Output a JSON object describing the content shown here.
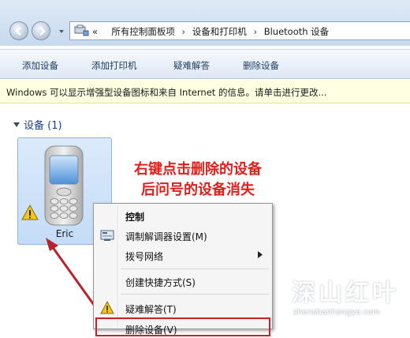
{
  "breadcrumb": {
    "lead": "«",
    "items": [
      "所有控制面板项",
      "设备和打印机",
      "Bluetooth 设备"
    ],
    "separator": "›"
  },
  "toolbar": {
    "add_device": "添加设备",
    "add_printer": "添加打印机",
    "troubleshoot": "疑难解答",
    "remove_device": "删除设备"
  },
  "infobar": {
    "text": "Windows 可以显示增强型设备图标和来自 Internet 的信息。请单击进行更改..."
  },
  "devices_group": {
    "title": "设备 (1)",
    "device_name": "Eric"
  },
  "annotation": {
    "line1": "右键点击删除的设备",
    "line2": "后问号的设备消失"
  },
  "context_menu": {
    "items": [
      {
        "label": "控制",
        "bold": true
      },
      {
        "label": "调制解调器设置(M)"
      },
      {
        "label": "拨号网络",
        "submenu": true
      },
      {
        "label": "创建快捷方式(S)"
      },
      {
        "label": "疑难解答(T)"
      },
      {
        "label": "删除设备(V)"
      }
    ]
  },
  "watermark": {
    "big": "深山红叶",
    "small": "shenshanhongye.com"
  },
  "colors": {
    "annotation": "#e0201c",
    "highlight_box": "#d21f1f",
    "group_title": "#1e3f8a",
    "infobar_bg": "#ffffe1"
  }
}
